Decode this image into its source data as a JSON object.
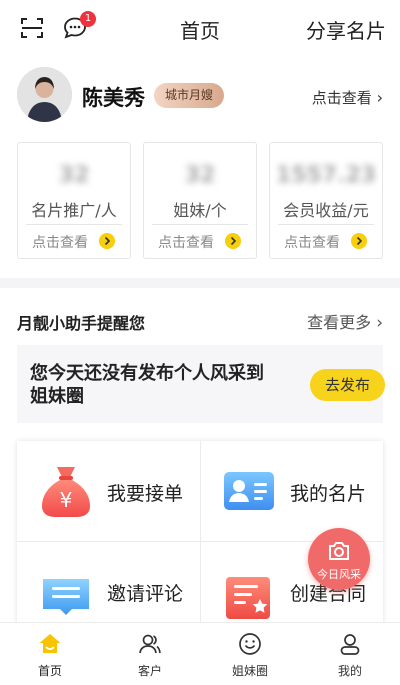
{
  "header": {
    "title": "首页",
    "share_label": "分享名片",
    "message_badge": "1"
  },
  "profile": {
    "name": "陈美秀",
    "role": "城市月嫂",
    "view_label": "点击查看"
  },
  "stats": [
    {
      "value": "32",
      "label": "名片推广/人",
      "action": "点击查看"
    },
    {
      "value": "32",
      "label": "姐妹/个",
      "action": "点击查看"
    },
    {
      "value": "1557.23",
      "label": "会员收益/元",
      "action": "点击查看"
    }
  ],
  "assistant": {
    "title": "月靓小助手提醒您",
    "more_label": "查看更多",
    "notice_text": "您今天还没有发布个人风采到姐妹圈",
    "publish_label": "去发布"
  },
  "grid": [
    {
      "label": "我要接单",
      "icon": "money-bag-icon"
    },
    {
      "label": "我的名片",
      "icon": "id-card-icon"
    },
    {
      "label": "邀请评论",
      "icon": "comment-icon"
    },
    {
      "label": "创建合同",
      "icon": "contract-icon"
    }
  ],
  "fab": {
    "label": "今日风采",
    "icon": "camera-icon"
  },
  "tabs": [
    {
      "label": "首页",
      "icon": "home-icon",
      "active": true
    },
    {
      "label": "客户",
      "icon": "customers-icon",
      "active": false
    },
    {
      "label": "姐妹圈",
      "icon": "sisters-circle-icon",
      "active": false
    },
    {
      "label": "我的",
      "icon": "profile-icon",
      "active": false
    }
  ],
  "colors": {
    "accent_yellow": "#f8d31b",
    "fab_red": "#f06a6a",
    "badge_red": "#f0323c",
    "role_badge": "#d7a98d"
  }
}
